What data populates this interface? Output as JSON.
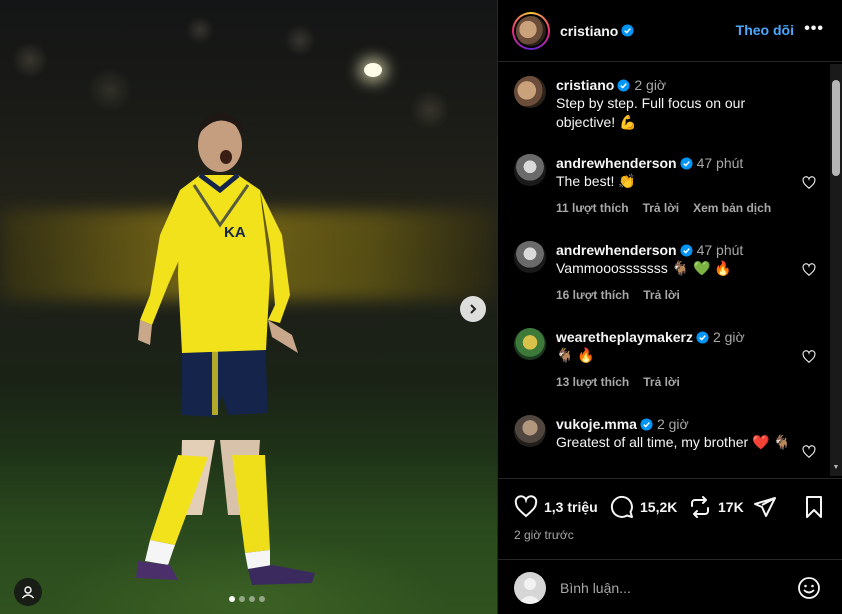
{
  "post": {
    "author": "cristiano",
    "follow_label": "Theo dõi",
    "more_label": "•••",
    "slide_count": 4,
    "active_slide": 1
  },
  "caption": {
    "username": "cristiano",
    "time": "2 giờ",
    "text": "Step by step. Full focus on our objective! 💪"
  },
  "comments": [
    {
      "username": "andrewhenderson",
      "time": "47 phút",
      "text": "The best! 👏",
      "likes": "11 lượt thích",
      "reply": "Trả lời",
      "translate": "Xem bản dịch"
    },
    {
      "username": "andrewhenderson",
      "time": "47 phút",
      "text": "Vammooosssssss 🐐 💚 🔥",
      "likes": "16 lượt thích",
      "reply": "Trả lời"
    },
    {
      "username": "wearetheplaymakerz",
      "time": "2 giờ",
      "text": "🐐 🔥",
      "likes": "13 lượt thích",
      "reply": "Trả lời"
    },
    {
      "username": "vukoje.mma",
      "time": "2 giờ",
      "text": "Greatest of all time, my brother ❤️ 🐐"
    }
  ],
  "actions": {
    "likes": "1,3 triệu",
    "comments": "15,2K",
    "reposts": "17K",
    "posted_time": "2 giờ trước"
  },
  "composer": {
    "placeholder": "Bình luận..."
  },
  "colors": {
    "accent_link": "#4aa8ff",
    "verified": "#0095f6",
    "background": "#000000",
    "jersey": "#f2e21c"
  },
  "icons": [
    "heart-icon",
    "comment-icon",
    "repost-icon",
    "share-icon",
    "bookmark-icon",
    "emoji-icon",
    "verified-icon",
    "chevron-right-icon",
    "user-tag-icon"
  ]
}
